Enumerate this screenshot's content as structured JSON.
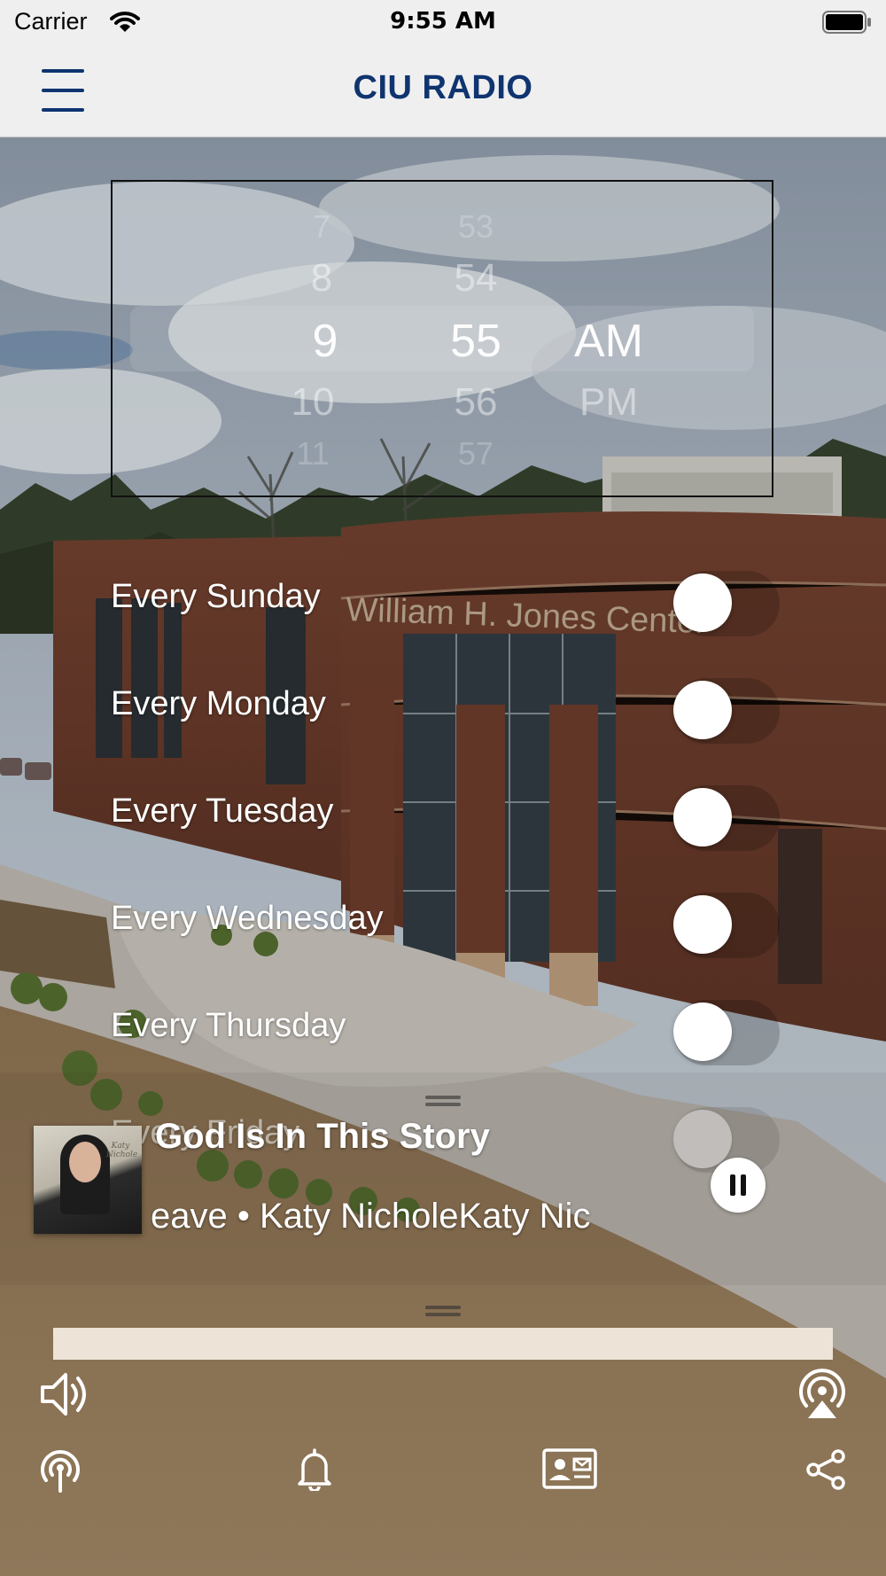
{
  "status_bar": {
    "carrier": "Carrier",
    "time": "9:55 AM",
    "icons": [
      "wifi-icon",
      "battery-icon"
    ]
  },
  "header": {
    "title": "CIU RADIO",
    "menu_icon": "hamburger-menu-icon",
    "title_color": "#0f3470"
  },
  "background": {
    "sign_text": "William H. Jones Center"
  },
  "time_picker": {
    "hours": [
      "7",
      "8",
      "9",
      "10",
      "11"
    ],
    "minutes": [
      "53",
      "54",
      "55",
      "56",
      "57"
    ],
    "periods": [
      "AM",
      "PM"
    ],
    "selected": {
      "hour": "9",
      "minute": "55",
      "period": "AM"
    }
  },
  "repeat_days": [
    {
      "label": "Every Sunday",
      "enabled": false
    },
    {
      "label": "Every Monday",
      "enabled": false
    },
    {
      "label": "Every Tuesday",
      "enabled": false
    },
    {
      "label": "Every Wednesday",
      "enabled": false
    },
    {
      "label": "Every Thursday",
      "enabled": false
    },
    {
      "label": "Every Friday",
      "enabled": false
    }
  ],
  "now_playing": {
    "title": "God Is In This Story",
    "subtitle": "eave • Katy NicholeKaty Nic",
    "artwork_icon": "album-artwork",
    "artwork_text": "Katy Nichole",
    "play_state": "pause-icon"
  },
  "progress": {
    "fraction": 1.0,
    "color": "#ede4d7"
  },
  "controls": {
    "volume_icon": "volume-icon",
    "airplay_icon": "airplay-icon"
  },
  "bottom_bar": [
    "radio-stream-icon",
    "bell-icon",
    "contact-card-icon",
    "share-icon"
  ]
}
